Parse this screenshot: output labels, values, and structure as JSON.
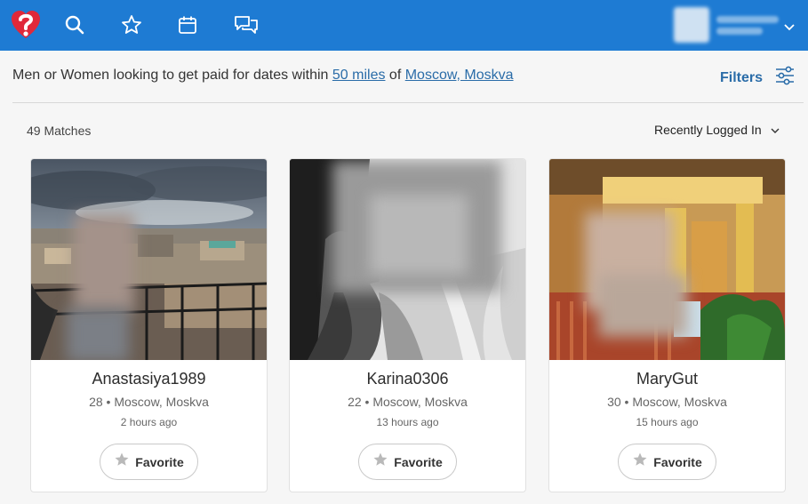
{
  "nav": {
    "icons": [
      "logo-icon",
      "search-icon",
      "star-icon",
      "calendar-icon",
      "chat-icon",
      "chevron-down-icon"
    ],
    "colors": {
      "bar": "#1e7bd3",
      "logo": "#e0283a"
    }
  },
  "search": {
    "prefix": "Men or Women looking to get paid for dates within ",
    "distance": "50 miles",
    "mid": " of ",
    "location": "Moscow, Moskva",
    "filters_label": "Filters"
  },
  "results": {
    "count_label": "49 Matches",
    "sort_label": "Recently Logged In"
  },
  "cards": [
    {
      "name": "Anastasiya1989",
      "meta": "28 • Moscow, Moskva",
      "time": "2 hours ago",
      "favorite_label": "Favorite"
    },
    {
      "name": "Karina0306",
      "meta": "22 • Moscow, Moskva",
      "time": "13 hours ago",
      "favorite_label": "Favorite"
    },
    {
      "name": "MaryGut",
      "meta": "30 • Moscow, Moskva",
      "time": "15 hours ago",
      "favorite_label": "Favorite"
    }
  ],
  "colors": {
    "link": "#2a6ca8",
    "accent": "#1e7bd3"
  }
}
